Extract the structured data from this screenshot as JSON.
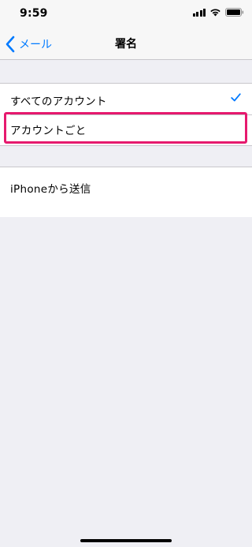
{
  "status_bar": {
    "time": "9:59",
    "icons": [
      "cellular-signal-icon",
      "wifi-icon",
      "battery-icon"
    ]
  },
  "nav": {
    "back_label": "メール",
    "title": "署名"
  },
  "groups": [
    {
      "items": [
        {
          "label": "すべてのアカウント",
          "selected": true
        },
        {
          "label": "アカウントごと",
          "selected": false,
          "highlighted": true
        }
      ]
    },
    {
      "items": [
        {
          "label": "iPhoneから送信"
        }
      ]
    }
  ],
  "colors": {
    "accent": "#007aff",
    "highlight": "#e6196e",
    "background": "#efeff4",
    "separator": "#c8c7cc"
  }
}
